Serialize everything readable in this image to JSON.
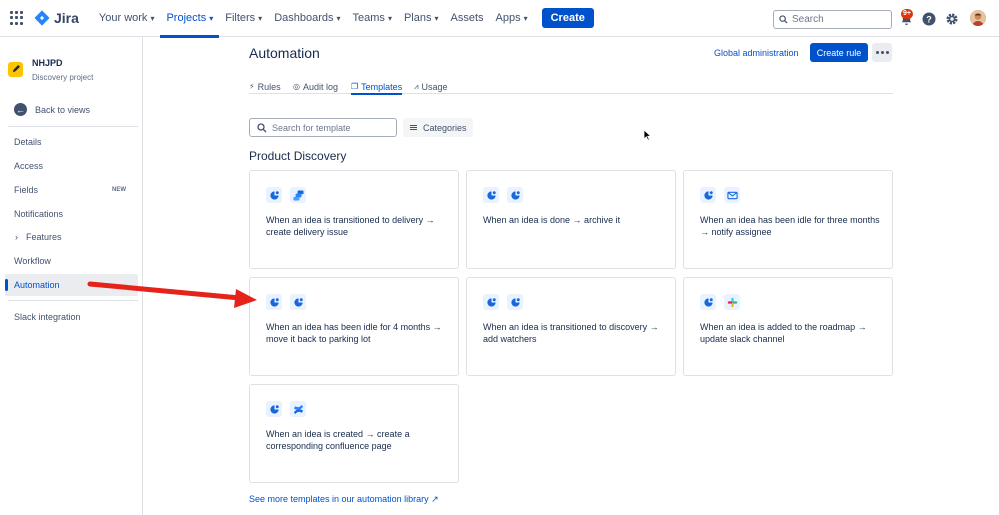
{
  "topnav": {
    "logo_text": "Jira",
    "items": [
      {
        "label": "Your work",
        "has_chevron": true
      },
      {
        "label": "Projects",
        "has_chevron": true,
        "active": true
      },
      {
        "label": "Filters",
        "has_chevron": true
      },
      {
        "label": "Dashboards",
        "has_chevron": true
      },
      {
        "label": "Teams",
        "has_chevron": true
      },
      {
        "label": "Plans",
        "has_chevron": true
      },
      {
        "label": "Assets",
        "has_chevron": false
      },
      {
        "label": "Apps",
        "has_chevron": true
      }
    ],
    "create_label": "Create",
    "search_placeholder": "Search",
    "notifications_badge": "9+",
    "icons": [
      "notification-icon",
      "help-icon",
      "settings-icon",
      "avatar"
    ]
  },
  "sidebar": {
    "project_name": "NHJPD",
    "project_type": "Discovery project",
    "back_label": "Back to views",
    "items": [
      {
        "label": "Details"
      },
      {
        "label": "Access"
      },
      {
        "label": "Fields",
        "tag": "NEW"
      },
      {
        "label": "Notifications"
      },
      {
        "label": "Features",
        "expandable": true
      },
      {
        "label": "Workflow"
      },
      {
        "label": "Automation",
        "active": true
      }
    ],
    "extra_item": "Slack integration"
  },
  "main": {
    "title": "Automation",
    "global_admin": "Global administration",
    "create_rule": "Create rule",
    "tabs": [
      {
        "label": "Rules",
        "icon": "bolt-icon"
      },
      {
        "label": "Audit log",
        "icon": "check-circle-icon"
      },
      {
        "label": "Templates",
        "icon": "copy-icon",
        "active": true
      },
      {
        "label": "Usage",
        "icon": "chart-icon"
      }
    ],
    "template_search_placeholder": "Search for template",
    "categories_label": "Categories",
    "section_title": "Product Discovery",
    "templates": [
      {
        "text": "When an idea is transitioned to delivery → create delivery issue",
        "icons": [
          "discovery-icon",
          "jira-icon"
        ]
      },
      {
        "text": "When an idea is done → archive it",
        "icons": [
          "discovery-icon",
          "discovery-icon"
        ]
      },
      {
        "text": "When an idea has been idle for three months → notify assignee",
        "icons": [
          "discovery-icon",
          "mail-icon"
        ]
      },
      {
        "text": "When an idea has been idle for 4 months → move it back to parking lot",
        "icons": [
          "discovery-icon",
          "discovery-icon"
        ]
      },
      {
        "text": "When an idea is transitioned to discovery → add watchers",
        "icons": [
          "discovery-icon",
          "discovery-icon"
        ]
      },
      {
        "text": "When an idea is added to the roadmap → update slack channel",
        "icons": [
          "discovery-icon",
          "slack-icon"
        ]
      },
      {
        "text": "When an idea is created → create a corresponding confluence page",
        "icons": [
          "discovery-icon",
          "confluence-icon"
        ]
      }
    ],
    "library_link": "See more templates in our automation library ↗"
  },
  "colors": {
    "primary": "#0052cc",
    "annotation_arrow": "#e5231b",
    "project_icon": "#ffc400",
    "badge": "#de350b"
  }
}
